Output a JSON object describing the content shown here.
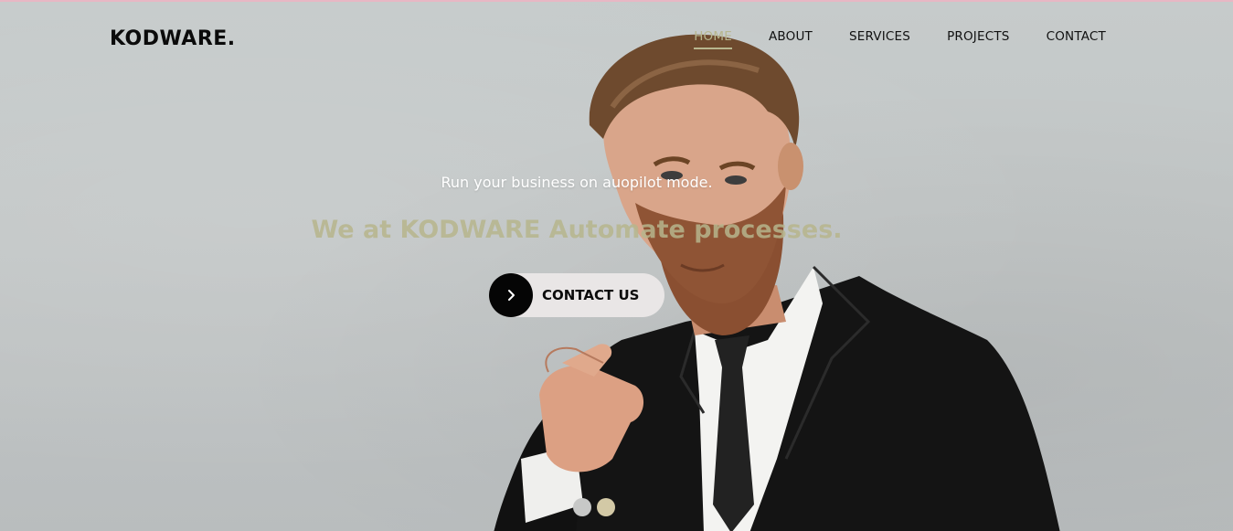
{
  "header": {
    "logo": "KODWARE.",
    "nav": [
      {
        "label": "HOME",
        "active": true
      },
      {
        "label": "ABOUT",
        "active": false
      },
      {
        "label": "SERVICES",
        "active": false
      },
      {
        "label": "PROJECTS",
        "active": false
      },
      {
        "label": "CONTACT",
        "active": false
      }
    ]
  },
  "hero": {
    "tagline": "Run your business on auopilot mode.",
    "headline": "We at KODWARE Automate processes.",
    "cta_label": "CONTACT US",
    "cta_icon": "chevron-right-icon",
    "slides": 2,
    "active_slide": 2
  },
  "colors": {
    "accent": "#b7b68e",
    "background": "#c4c8c8",
    "cta_background": "#e9e6e6",
    "cta_circle": "#050505",
    "dot_inactive": "#c7c8c7",
    "dot_active": "#d3c9a6"
  }
}
